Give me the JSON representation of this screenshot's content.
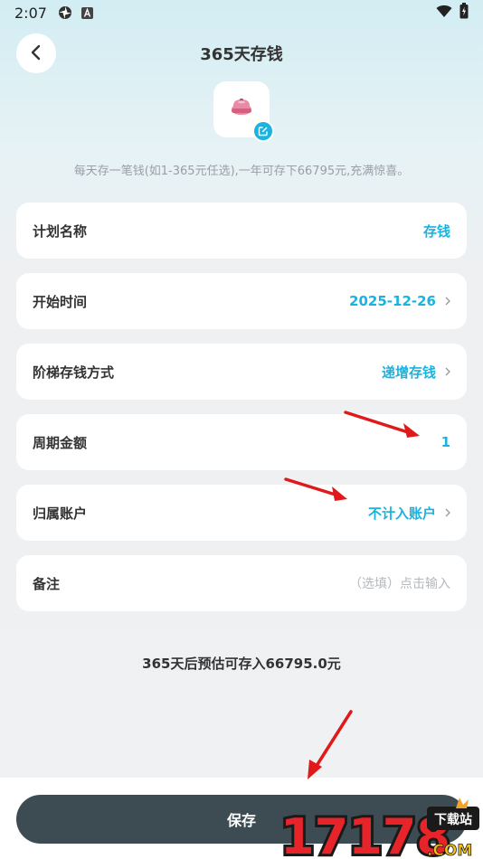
{
  "status_bar": {
    "time": "2:07",
    "icons": [
      "settings-flower-icon",
      "a-letter-icon",
      "wifi-icon",
      "battery-icon"
    ]
  },
  "header": {
    "back_icon": "chevron-left-icon",
    "title": "365天存钱"
  },
  "plan_icon": {
    "icon": "piggy-bank-icon",
    "edit_icon": "edit-icon"
  },
  "description": "每天存一笔钱(如1-365元任选),一年可存下66795元,充满惊喜。",
  "form": {
    "plan_name": {
      "label": "计划名称",
      "value": "存钱"
    },
    "start_time": {
      "label": "开始时间",
      "value": "2025-12-26"
    },
    "ladder_mode": {
      "label": "阶梯存钱方式",
      "value": "递增存钱"
    },
    "period_amount": {
      "label": "周期金额",
      "value": "1"
    },
    "account": {
      "label": "归属账户",
      "value": "不计入账户"
    },
    "remark": {
      "label": "备注",
      "placeholder": "（选填）点击输入"
    }
  },
  "estimate": "365天后预估可存入66795.0元",
  "save_label": "保存",
  "watermark": {
    "number": "17178",
    "suffix": ".COM",
    "tag": "下载站"
  },
  "colors": {
    "accent": "#1ab3df",
    "save_button": "#3d4c53",
    "annotation_arrow": "#e0191b"
  }
}
